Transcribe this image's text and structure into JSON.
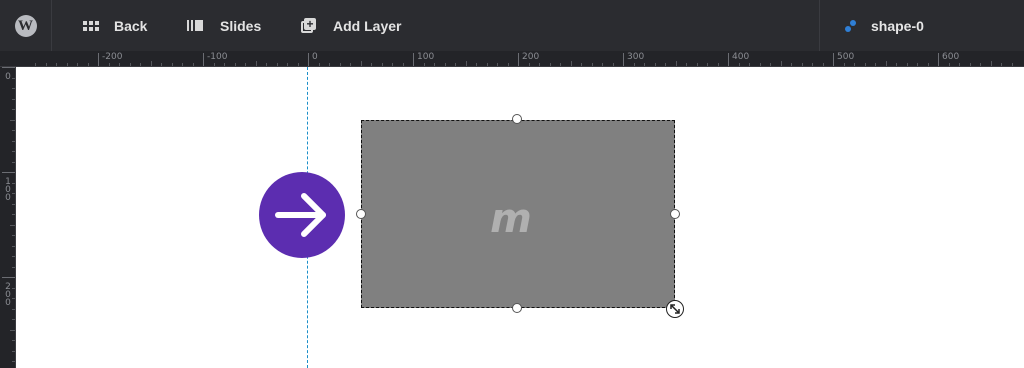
{
  "toolbar": {
    "back_label": "Back",
    "slides_label": "Slides",
    "add_layer_label": "Add Layer",
    "wp_logo_letter": "W",
    "background_color": "#2b2c30",
    "icons": {
      "wordpress": "wordpress-icon",
      "back": "grid-icon",
      "slides": "slides-icon",
      "add_layer": "add-layer-icon",
      "layer": "shape-layer-icon"
    }
  },
  "layer_selector": {
    "name": "shape-0",
    "accent_color": "#2f7fd6"
  },
  "rulers": {
    "horizontal": [
      "-200",
      "-100",
      "0",
      "100",
      "200",
      "300",
      "400",
      "500",
      "600"
    ],
    "vertical": [
      "0",
      "100",
      "200"
    ],
    "marker_color": "#d63f7e"
  },
  "canvas": {
    "guide_color": "#1b8fc9",
    "arrow_button": {
      "icon": "arrow-right-icon",
      "color": "#5c2db0"
    },
    "shape": {
      "fill_color": "#808080",
      "logo_letter": "m"
    }
  }
}
